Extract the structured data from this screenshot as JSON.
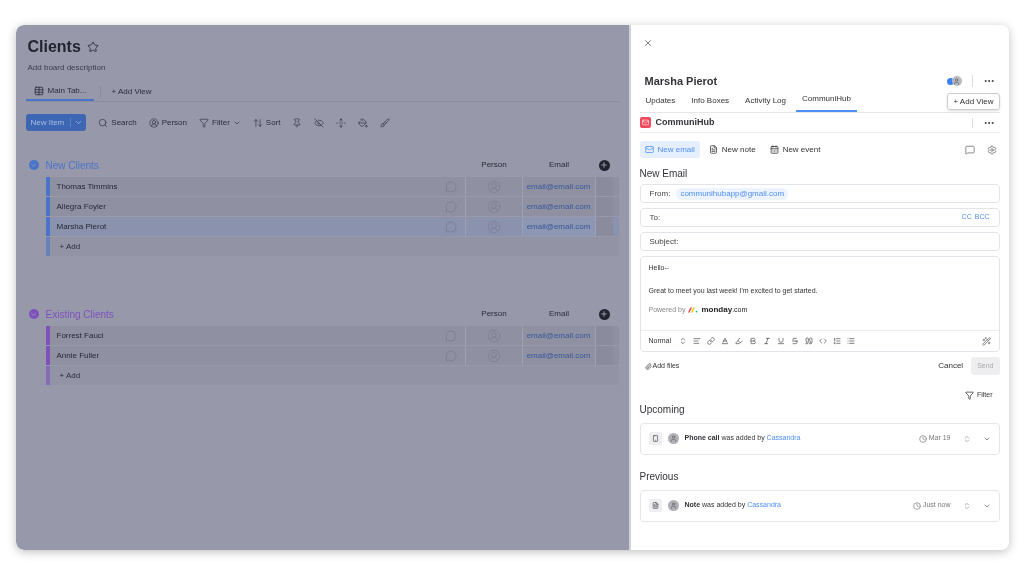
{
  "board": {
    "title": "Clients",
    "description": "Add board description",
    "views": [
      {
        "label": "Main Tab...",
        "selected": true
      }
    ],
    "add_view": "+ Add View",
    "toolbar": {
      "new_item": "New Item",
      "items": [
        "Search",
        "Person",
        "Filter",
        "Sort"
      ]
    },
    "groups": [
      {
        "name": "New Clients",
        "color": "#4a74cc",
        "columns": [
          "Person",
          "Email"
        ],
        "add": "+ Add",
        "rows": [
          {
            "name": "Thomas Timmins",
            "email": "email@email.com",
            "selected": false
          },
          {
            "name": "Allegra Foyler",
            "email": "email@email.com",
            "selected": false
          },
          {
            "name": "Marsha Pierot",
            "email": "email@email.com",
            "selected": true
          }
        ]
      },
      {
        "name": "Existing Clients",
        "color": "#7d52bd",
        "columns": [
          "Person",
          "Email"
        ],
        "add": "+ Add",
        "rows": [
          {
            "name": "Forrest Fauci",
            "email": "email@email.com",
            "selected": false
          },
          {
            "name": "Annie Fuller",
            "email": "email@email.com",
            "selected": false
          }
        ]
      }
    ]
  },
  "panel": {
    "title": "Marsha Pierot",
    "tabs": [
      {
        "label": "Updates",
        "selected": false
      },
      {
        "label": "Info Boxes",
        "selected": false
      },
      {
        "label": "Activity Log",
        "selected": false
      },
      {
        "label": "CommuniHub",
        "selected": true
      }
    ],
    "add_view": "+ Add View",
    "app_name": "CommuniHub",
    "actions": [
      {
        "label": "New email",
        "selected": true
      },
      {
        "label": "New note",
        "selected": false
      },
      {
        "label": "New event",
        "selected": false
      }
    ],
    "email": {
      "heading": "New Email",
      "from_label": "From:",
      "from": "communihubapp@gmail.com",
      "to_label": "To:",
      "cc": "CC",
      "bcc": "BCC",
      "subject_label": "Subject:",
      "body": [
        "Hello--",
        "Great to meet you last week! I'm excited to get started."
      ],
      "powered_by": "Powered by",
      "logo_word": "monday",
      "logo_suffix": ".com",
      "format": "Normal",
      "add_files": "Add files",
      "cancel": "Cancel",
      "send": "Send",
      "send_disabled": true
    },
    "filter": "Filter",
    "sections": [
      {
        "title": "Upcoming",
        "items": [
          {
            "kind": "phone",
            "subject": "Phone call",
            "verb": " was added by ",
            "author": "Cassandra",
            "time": "Mar 19"
          }
        ]
      },
      {
        "title": "Previous",
        "items": [
          {
            "kind": "note",
            "subject": "Note",
            "verb": " was added by ",
            "author": "Cassandra",
            "time": "Just now"
          }
        ]
      }
    ]
  }
}
